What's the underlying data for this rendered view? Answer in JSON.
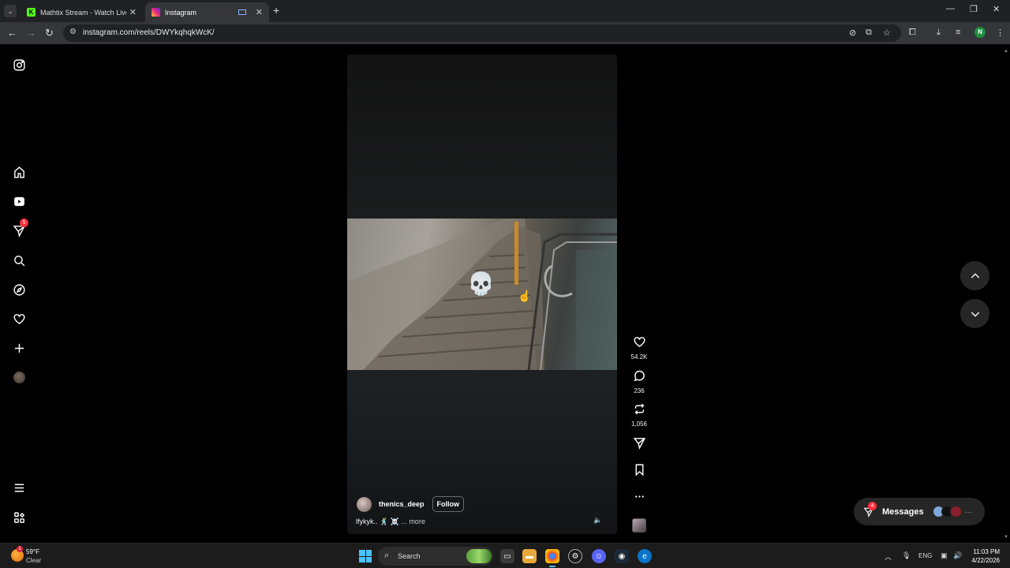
{
  "browser": {
    "tabs": [
      {
        "title": "Mathtix Stream - Watch Live on",
        "active": false
      },
      {
        "title": "Instagram",
        "active": true
      }
    ],
    "url": "instagram.com/reels/DWYkqhqkWcK/",
    "profile_initial": "N"
  },
  "sidebar": {
    "notifications_count": "5"
  },
  "reel": {
    "username": "thenics_deep",
    "follow_label": "Follow",
    "caption": "lfykyk.. 🕺 ☠️",
    "more_label": "... more",
    "overlay_emoji": "💀",
    "likes": "54.2K",
    "comments": "236",
    "reposts": "1,056"
  },
  "messages": {
    "label": "Messages",
    "unread_count": "4",
    "more": "···"
  },
  "taskbar": {
    "temperature": "59°F",
    "condition": "Clear",
    "weather_badge": "1",
    "search_label": "Search",
    "language": "ENG",
    "time": "11:03 PM",
    "date": "4/22/2026"
  },
  "colors": {
    "accent_blue": "#4cc2ff",
    "notification_red": "#ff3040",
    "profile_green": "#1e8e3e"
  }
}
